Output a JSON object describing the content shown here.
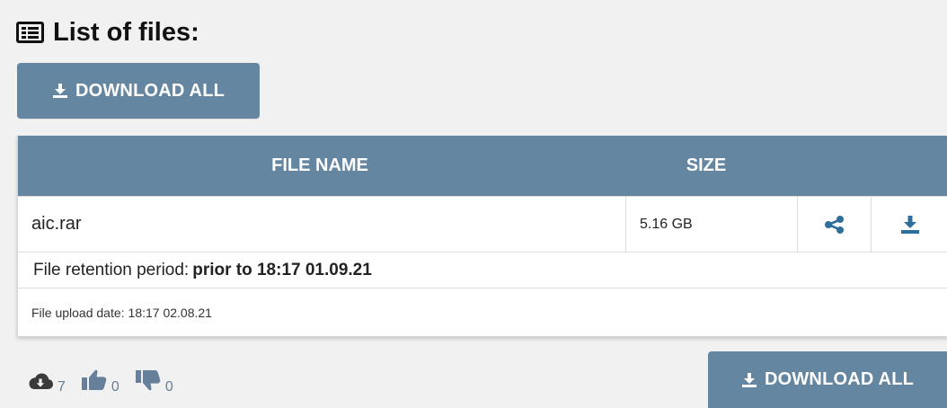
{
  "page": {
    "title": "List of files:",
    "accent_color": "#6486a1",
    "icon_color": "#2d6f9d"
  },
  "actions": {
    "download_all_label": "DOWNLOAD ALL"
  },
  "table": {
    "headers": {
      "file_name": "FILE NAME",
      "size": "SIZE"
    },
    "rows": [
      {
        "file_name": "aic.rar",
        "size": "5.16 GB"
      }
    ],
    "icons": {
      "share": "share-icon",
      "download": "download-icon"
    }
  },
  "file_info": {
    "retention_label": "File retention period:",
    "retention_value": "prior to 18:17 01.09.21",
    "upload_label": "File upload date:",
    "upload_value": "18:17 02.08.21"
  },
  "stats": {
    "downloads": "7",
    "likes": "0",
    "dislikes": "0"
  },
  "icons": {
    "title": "list-icon",
    "download_button": "download-icon",
    "stats_downloads": "cloud-download-icon",
    "stats_likes": "thumbs-up-icon",
    "stats_dislikes": "thumbs-down-icon"
  }
}
